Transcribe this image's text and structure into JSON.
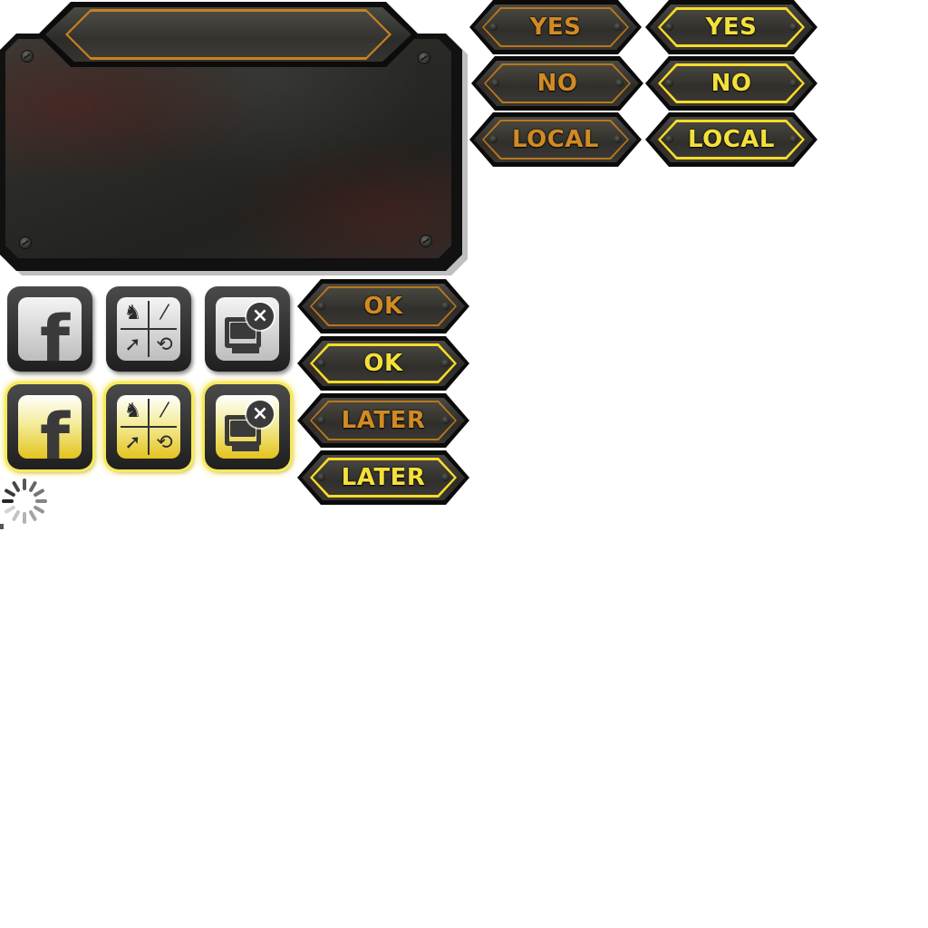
{
  "dialog": {
    "title": ""
  },
  "buttons_right": [
    {
      "label": "YES",
      "state": "normal"
    },
    {
      "label": "YES",
      "state": "highlighted"
    },
    {
      "label": "NO",
      "state": "normal"
    },
    {
      "label": "NO",
      "state": "highlighted"
    },
    {
      "label": "LOCAL",
      "state": "normal"
    },
    {
      "label": "LOCAL",
      "state": "highlighted"
    }
  ],
  "buttons_lower": [
    {
      "label": "OK",
      "state": "normal"
    },
    {
      "label": "OK",
      "state": "highlighted"
    },
    {
      "label": "LATER",
      "state": "normal"
    },
    {
      "label": "LATER",
      "state": "highlighted"
    }
  ],
  "icon_buttons": [
    {
      "icon": "facebook-icon",
      "state": "normal"
    },
    {
      "icon": "game-modes-icon",
      "state": "normal"
    },
    {
      "icon": "disconnect-icon",
      "state": "normal"
    },
    {
      "icon": "facebook-icon",
      "state": "highlighted"
    },
    {
      "icon": "game-modes-icon",
      "state": "highlighted"
    },
    {
      "icon": "disconnect-icon",
      "state": "highlighted"
    }
  ],
  "glyphs": {
    "facebook": "f",
    "knight": "♞",
    "wand": "⁄",
    "rocket": "➚",
    "timer": "⟲",
    "close": "×"
  },
  "colors": {
    "label_normal": "#d18a24",
    "label_highlight": "#f4e03a",
    "frame_normal": "#b7771c",
    "frame_highlight": "#f6dc2a",
    "metal_dark": "#2c2b28"
  }
}
